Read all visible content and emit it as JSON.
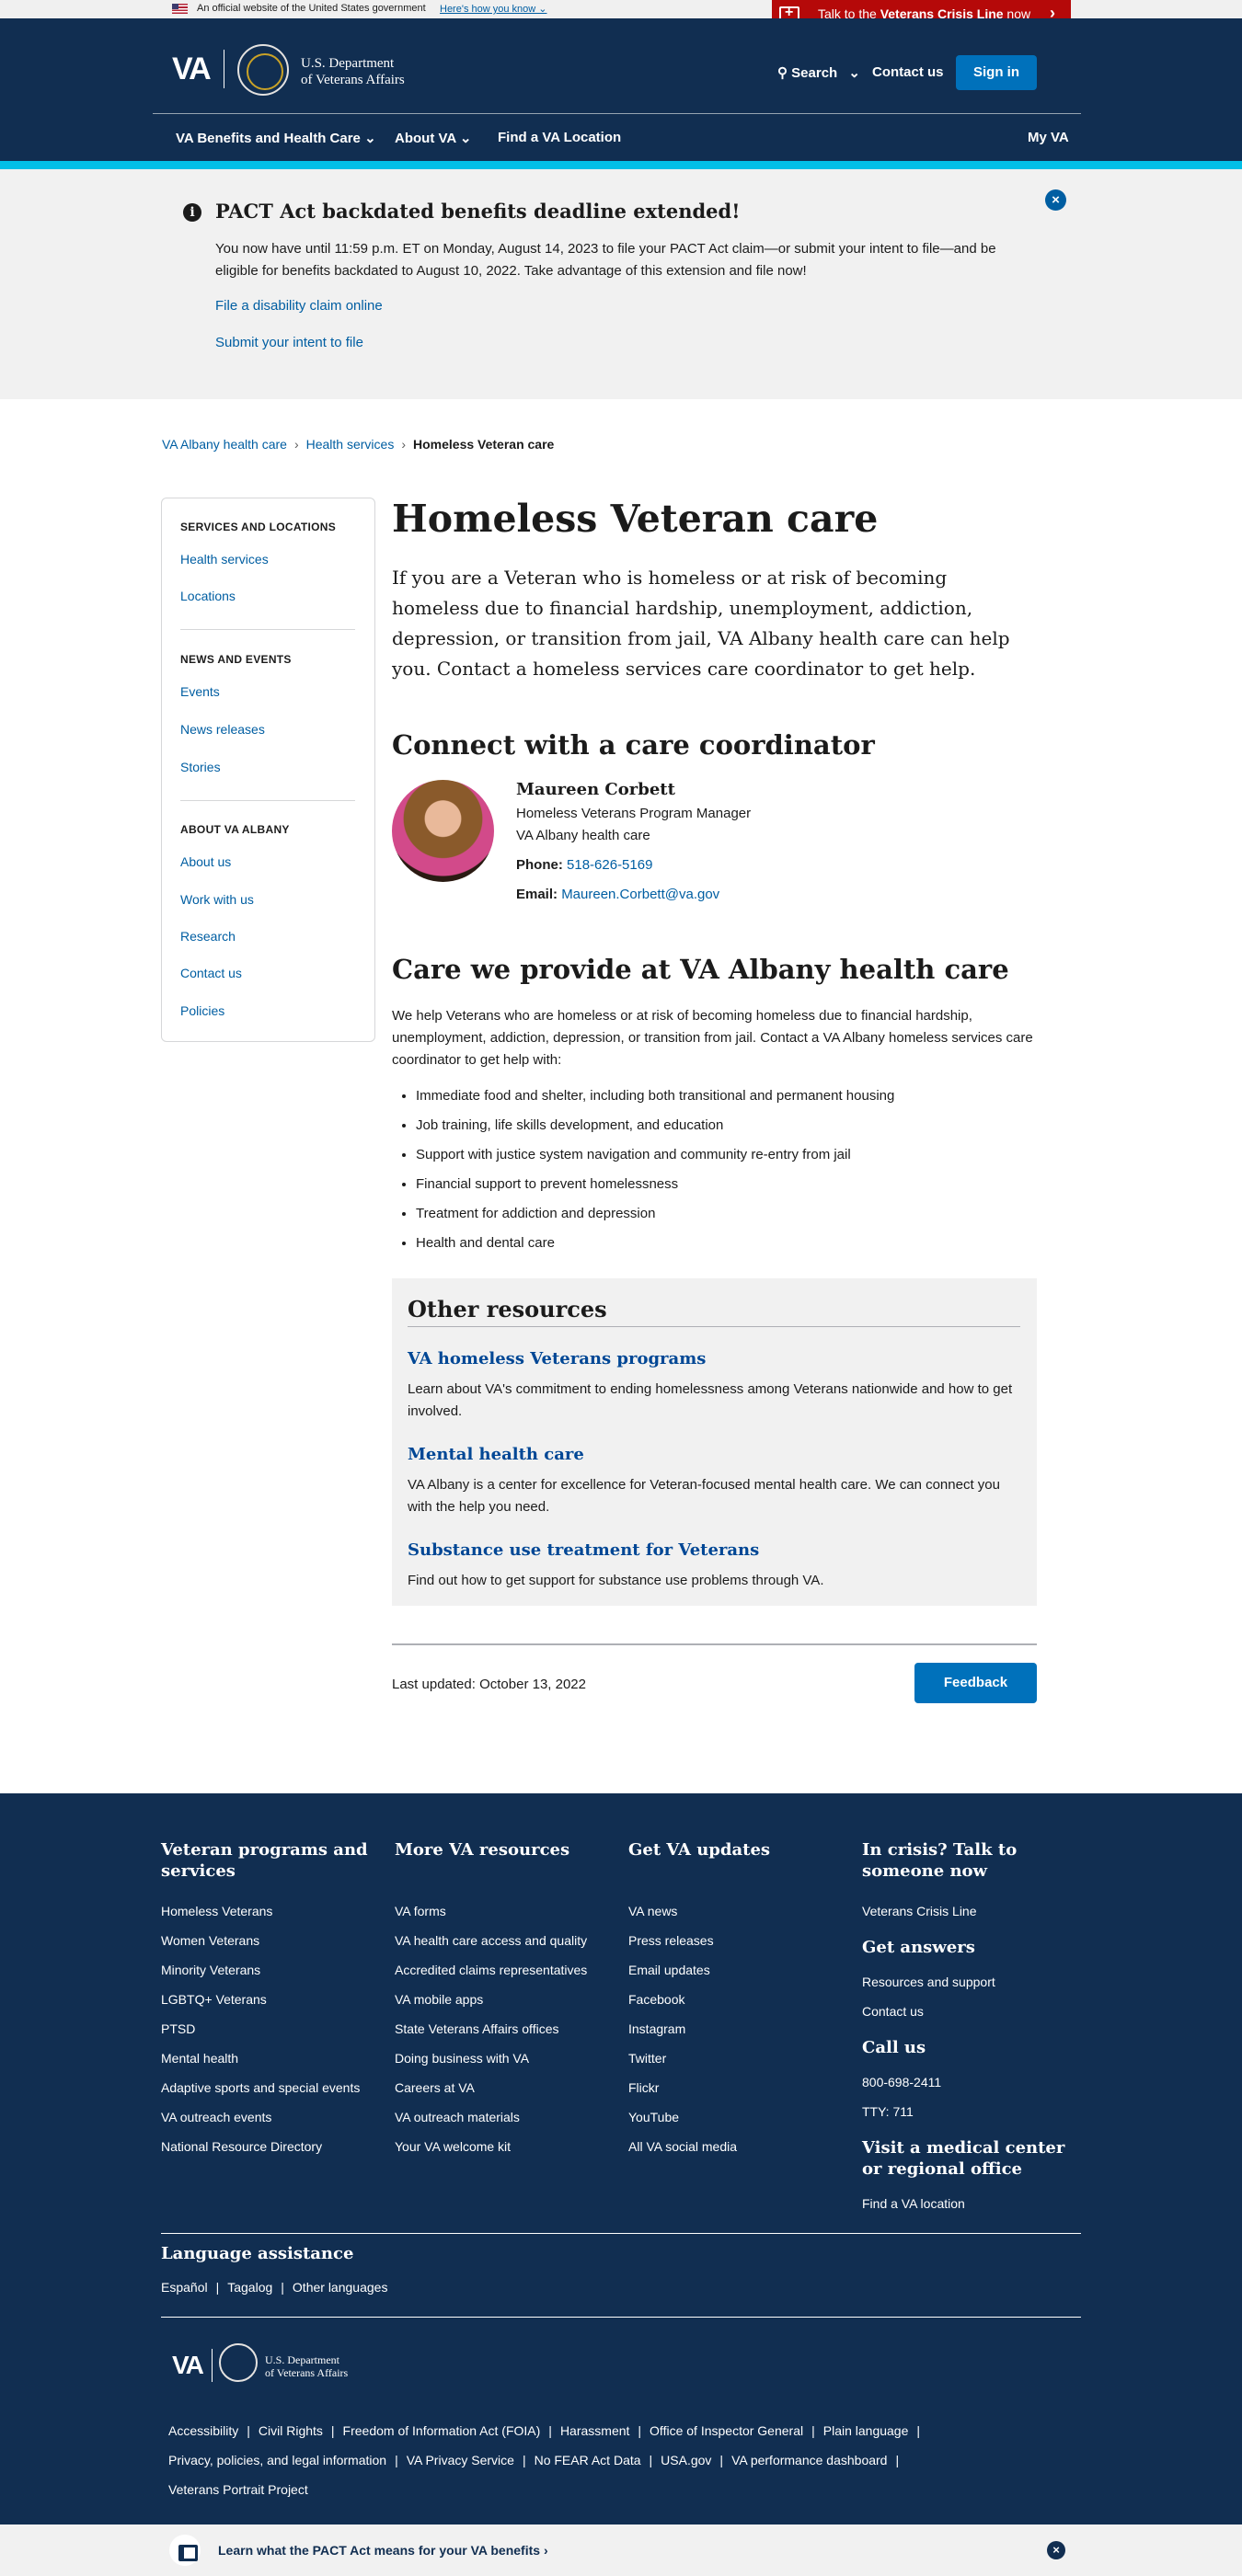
{
  "gov_banner": {
    "text": "An official website of the United States government",
    "link": "Here's how you know ⌄"
  },
  "crisis": {
    "prefix": "Talk to the ",
    "strong": "Veterans Crisis Line",
    "suffix": " now"
  },
  "header": {
    "logo": "VA",
    "dept_line1": "U.S. Department",
    "dept_line2": "of Veterans Affairs",
    "search": "Search",
    "contact": "Contact us",
    "signin": "Sign in",
    "nav": [
      "VA Benefits and Health Care",
      "About VA",
      "Find a VA Location"
    ],
    "my_va": "My VA"
  },
  "alert": {
    "title": "PACT Act backdated benefits deadline extended!",
    "body": "You now have until 11:59 p.m. ET on Monday, August 14, 2023 to file your PACT Act claim—or submit your intent to file—and be eligible for benefits backdated to August 10, 2022. Take advantage of this extension and file now!",
    "link1": "File a disability claim online",
    "link2": "Submit your intent to file"
  },
  "breadcrumb": [
    "VA Albany health care",
    "Health services",
    "Homeless Veteran care"
  ],
  "sidenav": {
    "sections": [
      {
        "title": "SERVICES AND LOCATIONS",
        "items": [
          "Health services",
          "Locations"
        ]
      },
      {
        "title": "NEWS AND EVENTS",
        "items": [
          "Events",
          "News releases",
          "Stories"
        ]
      },
      {
        "title": "ABOUT VA ALBANY",
        "items": [
          "About us",
          "Work with us",
          "Research",
          "Contact us",
          "Policies"
        ]
      }
    ]
  },
  "main": {
    "title": "Homeless Veteran care",
    "intro": "If you are a Veteran who is homeless or at risk of becoming homeless due to financial hardship, unemployment, addiction, depression, or transition from jail, VA Albany health care can help you. Contact a homeless services care coordinator to get help.",
    "connect_heading": "Connect with a care coordinator",
    "contact": {
      "name": "Maureen Corbett",
      "title": "Homeless Veterans Program Manager",
      "org": "VA Albany health care",
      "phone_label": "Phone:",
      "phone": "518-626-5169",
      "email_label": "Email:",
      "email": "Maureen.Corbett@va.gov"
    },
    "care_heading": "Care we provide at VA Albany health care",
    "care_intro": "We help Veterans who are homeless or at risk of becoming homeless due to financial hardship, unemployment, addiction, depression, or transition from jail. Contact a VA Albany homeless services care coordinator to get help with:",
    "care_list": [
      "Immediate food and shelter, including both transitional and permanent housing",
      "Job training, life skills development, and education",
      "Support with justice system navigation and community re-entry from jail",
      "Financial support to prevent homelessness",
      "Treatment for addiction and depression",
      "Health and dental care"
    ]
  },
  "other": {
    "heading": "Other resources",
    "items": [
      {
        "title": "VA homeless Veterans programs",
        "desc": "Learn about VA's commitment to ending homelessness among Veterans nationwide and how to get involved."
      },
      {
        "title": "Mental health care",
        "desc": "VA Albany is a center for excellence for Veteran-focused mental health care. We can connect you with the help you need."
      },
      {
        "title": "Substance use treatment for Veterans",
        "desc": "Find out how to get support for substance use problems through VA."
      }
    ]
  },
  "last_updated": "Last updated: October 13, 2022",
  "feedback": "Feedback",
  "footer": {
    "col1": {
      "title": "Veteran programs and services",
      "links": [
        "Homeless Veterans",
        "Women Veterans",
        "Minority Veterans",
        "LGBTQ+ Veterans",
        "PTSD",
        "Mental health",
        "Adaptive sports and special events",
        "VA outreach events",
        "National Resource Directory"
      ]
    },
    "col2": {
      "title": "More VA resources",
      "links": [
        "VA forms",
        "VA health care access and quality",
        "Accredited claims representatives",
        "VA mobile apps",
        "State Veterans Affairs offices",
        "Doing business with VA",
        "Careers at VA",
        "VA outreach materials",
        "Your VA welcome kit"
      ]
    },
    "col3": {
      "title": "Get VA updates",
      "links": [
        "VA news",
        "Press releases",
        "Email updates",
        "Facebook",
        "Instagram",
        "Twitter",
        "Flickr",
        "YouTube",
        "All VA social media"
      ]
    },
    "col4": {
      "crisis_title": "In crisis? Talk to someone now",
      "crisis_link": "Veterans Crisis Line",
      "answers_title": "Get answers",
      "answers_links": [
        "Resources and support",
        "Contact us"
      ],
      "call_title": "Call us",
      "call_links": [
        "800-698-2411",
        "TTY: 711"
      ],
      "visit_title": "Visit a medical center or regional office",
      "visit_link": "Find a VA location"
    },
    "lang_title": "Language assistance",
    "lang_links": [
      "Español",
      "Tagalog",
      "Other languages"
    ],
    "legal": [
      "Accessibility",
      "Civil Rights",
      "Freedom of Information Act (FOIA)",
      "Harassment",
      "Office of Inspector General",
      "Plain language",
      "Privacy, policies, and legal information",
      "VA Privacy Service",
      "No FEAR Act Data",
      "USA.gov",
      "VA performance dashboard",
      "Veterans Portrait Project"
    ]
  },
  "bottom_bar": {
    "text": "Learn what the PACT Act means for your VA benefits ›"
  },
  "colors": {
    "navy": "#112e51",
    "accent": "#02bfe7",
    "link": "#005ea2",
    "button": "#0071bb",
    "crisis": "#b50909"
  }
}
